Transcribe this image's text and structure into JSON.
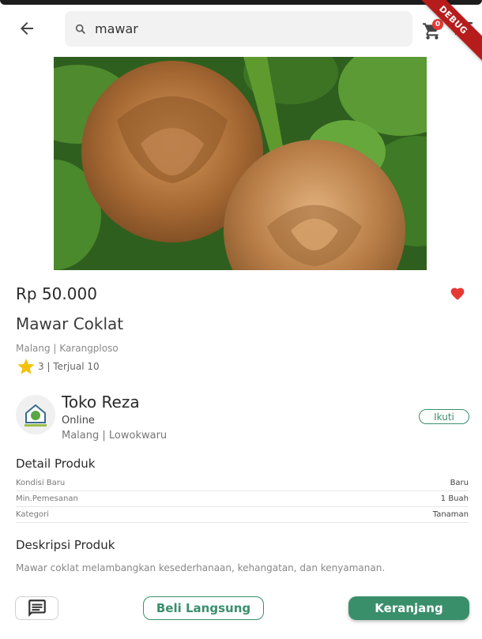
{
  "header": {
    "search_query": "mawar",
    "cart_count": "0",
    "debug_label": "DEBUG"
  },
  "product": {
    "price": "Rp 50.000",
    "name": "Mawar Coklat",
    "location": "Malang | Karangploso",
    "rating": "3",
    "sold": "3 | Terjual 10",
    "image_icon": "rose-photo",
    "favorited": true,
    "favorite_color": "#e53935"
  },
  "store": {
    "name": "Toko Reza",
    "status": "Online",
    "location": "Malang | Lowokwaru",
    "follow_label": "Ikuti"
  },
  "details": {
    "title": "Detail Produk",
    "rows": [
      {
        "label": "Kondisi Baru",
        "value": "Baru"
      },
      {
        "label": "Min.Pemesanan",
        "value": "1 Buah"
      },
      {
        "label": "Kategori",
        "value": "Tanaman"
      }
    ]
  },
  "description": {
    "title": "Deskripsi Produk",
    "text": "Mawar coklat melambangkan kesederhanaan, kehangatan, dan kenyamanan."
  },
  "actions": {
    "chat_icon": "chat-icon",
    "buy_now_label": "Beli Langsung",
    "add_to_cart_label": "Keranjang"
  },
  "colors": {
    "accent": "#3a8f6b",
    "debug_banner": "#b71c1c"
  }
}
